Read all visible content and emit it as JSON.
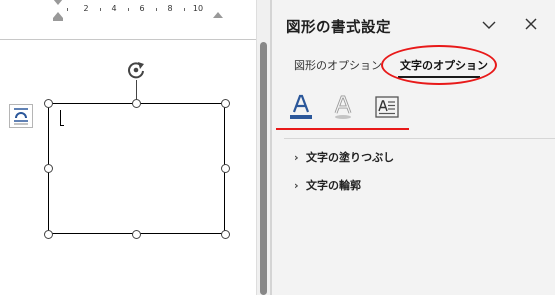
{
  "ruler": {
    "ticks": [
      "2",
      "4",
      "6",
      "8",
      "10"
    ]
  },
  "pane": {
    "title": "図形の書式設定",
    "tabs": [
      {
        "label": "図形のオプション",
        "selected": false
      },
      {
        "label": "文字のオプション",
        "selected": true
      }
    ],
    "icon_buttons": [
      "text-fill-outline-icon",
      "text-effects-icon",
      "textbox-layout-icon"
    ],
    "sections": [
      {
        "label": "文字の塗りつぶし",
        "expanded": false
      },
      {
        "label": "文字の輪郭",
        "expanded": false
      }
    ]
  },
  "colors": {
    "annotation": "#e81919",
    "accent": "#2b579a"
  }
}
